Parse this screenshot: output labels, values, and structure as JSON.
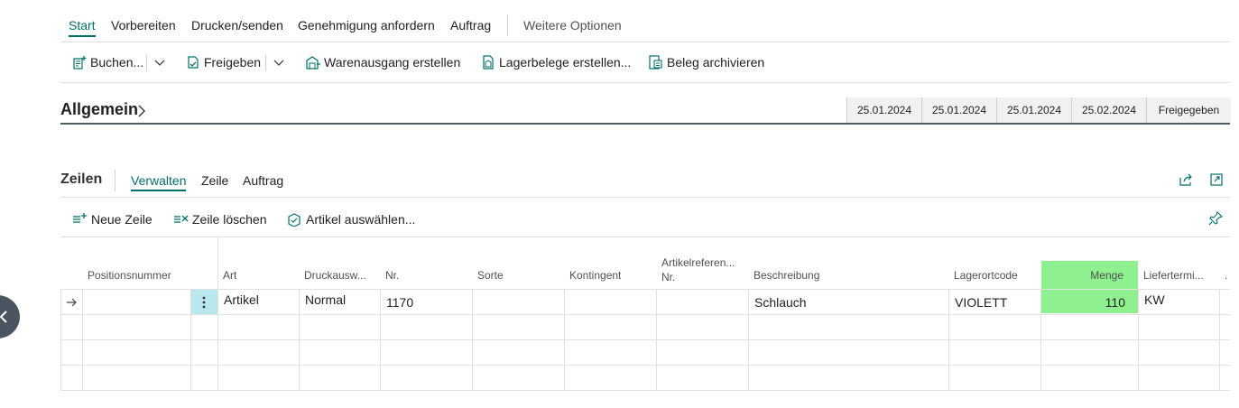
{
  "action_tabs": {
    "start": "Start",
    "prepare": "Vorbereiten",
    "print_send": "Drucken/senden",
    "request_approval": "Genehmigung anfordern",
    "order": "Auftrag",
    "more_options": "Weitere Optionen"
  },
  "toolbar": {
    "post": "Buchen...",
    "release": "Freigeben",
    "warehouse_shipment": "Warenausgang erstellen",
    "inventory_docs": "Lagerbelege erstellen...",
    "archive": "Beleg archivieren"
  },
  "general": {
    "title": "Allgemein",
    "summary": [
      "25.01.2024",
      "25.01.2024",
      "25.01.2024",
      "25.02.2024",
      "Freigegeben"
    ]
  },
  "lines": {
    "title": "Zeilen",
    "tabs": [
      "Verwalten",
      "Zeile",
      "Auftrag"
    ],
    "actions": {
      "new_line": "Neue Zeile",
      "delete_line": "Zeile löschen",
      "select_items": "Artikel auswählen..."
    },
    "columns": {
      "position": "Positionsnummer",
      "type": "Art",
      "print_sel": "Druckausw...",
      "no": "Nr.",
      "variant": "Sorte",
      "quota": "Kontingent",
      "item_ref_1": "Artikelreferen...",
      "item_ref_2": "Nr.",
      "description": "Beschreibung",
      "location": "Lagerortcode",
      "quantity": "Menge",
      "delivery": "Liefertermi..."
    },
    "row1": {
      "type": "Artikel",
      "print_sel": "Normal",
      "no": "1170",
      "description": "Schlauch",
      "location": "VIOLETT",
      "quantity": "110",
      "delivery": "KW"
    }
  },
  "colors": {
    "accent": "#00706b",
    "highlight_green": "#8ff08f",
    "highlight_cyan": "#b8e8ee"
  },
  "icons": [
    "post-icon",
    "release-icon",
    "warehouse-icon",
    "inventory-doc-icon",
    "archive-icon",
    "new-line-icon",
    "delete-line-icon",
    "select-items-icon",
    "share-icon",
    "expand-icon",
    "personalize-icon",
    "row-arrow-icon",
    "row-menu-icon",
    "chevron-down-icon",
    "chevron-right-icon",
    "back-arrow-icon"
  ]
}
